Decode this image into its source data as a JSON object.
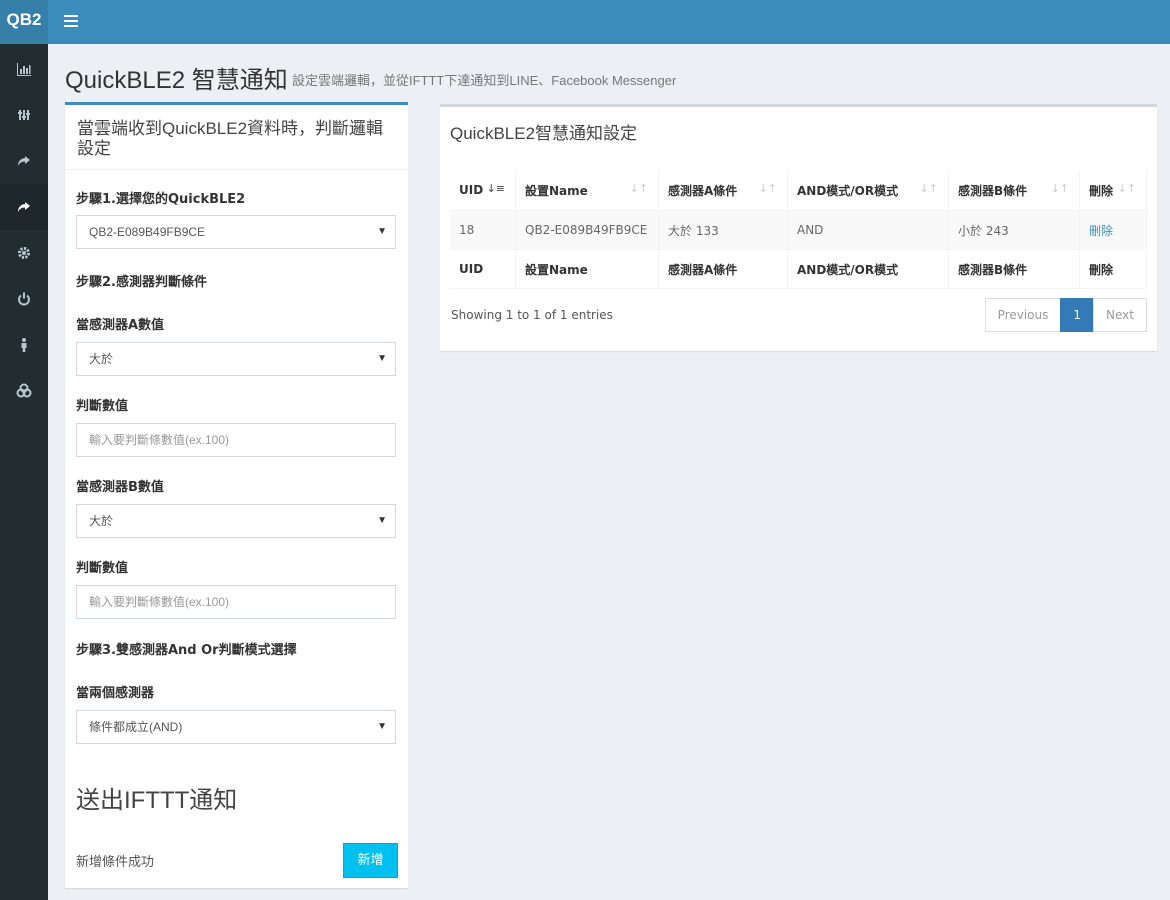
{
  "header": {
    "logo": "QB2"
  },
  "sidebar": {
    "items": [
      {
        "icon": "bar-chart-icon"
      },
      {
        "icon": "sliders-icon"
      },
      {
        "icon": "share-arrow-icon"
      },
      {
        "icon": "share-arrow-icon"
      },
      {
        "icon": "gear-icon"
      },
      {
        "icon": "power-icon"
      },
      {
        "icon": "person-icon"
      },
      {
        "icon": "cogs-icon"
      }
    ]
  },
  "page": {
    "title": "QuickBLE2 智慧通知",
    "subtitle": "設定雲端邏輯，並從IFTTT下達通知到LINE、Facebook Messenger"
  },
  "form": {
    "title": "當雲端收到QuickBLE2資料時，判斷邏輯設定",
    "step1": "步驟1.選擇您的QuickBLE2",
    "device_select": "QB2-E089B49FB9CE",
    "step2": "步驟2.感測器判斷條件",
    "sensor_a_label": "當感測器A數值",
    "sensor_a_select": "大於",
    "value_a_label": "判斷數值",
    "value_a_placeholder": "輸入要判斷條數值(ex.100)",
    "sensor_b_label": "當感測器B數值",
    "sensor_b_select": "大於",
    "value_b_label": "判斷數值",
    "value_b_placeholder": "輸入要判斷條數值(ex.100)",
    "step3": "步驟3.雙感測器And Or判斷模式選擇",
    "mode_label": "當兩個感測器",
    "mode_select": "條件都成立(AND)",
    "ifttt_title": "送出IFTTT通知",
    "success": "新增條件成功",
    "add_button": "新增"
  },
  "table": {
    "title": "QuickBLE2智慧通知設定",
    "columns": [
      "UID",
      "設置Name",
      "感測器A條件",
      "AND模式/OR模式",
      "感測器B條件",
      "刪除"
    ],
    "rows": [
      {
        "uid": "18",
        "name": "QB2-E089B49FB9CE",
        "cond_a": "大於 133",
        "mode": "AND",
        "cond_b": "小於 243",
        "delete": "刪除"
      }
    ],
    "info": "Showing 1 to 1 of 1 entries",
    "pagination": {
      "previous": "Previous",
      "page": "1",
      "next": "Next"
    }
  }
}
